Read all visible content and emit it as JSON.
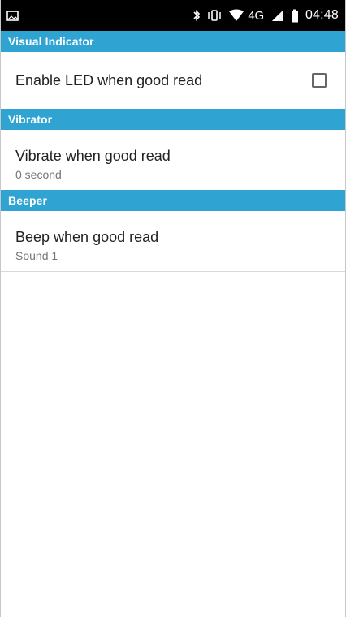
{
  "status_bar": {
    "time": "04:48",
    "network": "4G",
    "icons": [
      "image-notification-icon",
      "bluetooth-icon",
      "vibrate-icon",
      "wifi-icon",
      "signal-icon",
      "battery-icon"
    ]
  },
  "sections": {
    "visual_indicator": {
      "header": "Visual Indicator",
      "items": [
        {
          "title": "Enable LED when good read",
          "checked": false
        }
      ]
    },
    "vibrator": {
      "header": "Vibrator",
      "items": [
        {
          "title": "Vibrate when good read",
          "summary": "0 second"
        }
      ]
    },
    "beeper": {
      "header": "Beeper",
      "items": [
        {
          "title": "Beep when good read",
          "summary": "Sound 1"
        }
      ]
    }
  },
  "colors": {
    "section_header_bg": "#2fa4d2",
    "status_bar_bg": "#000000",
    "divider": "#d9d9d9"
  }
}
